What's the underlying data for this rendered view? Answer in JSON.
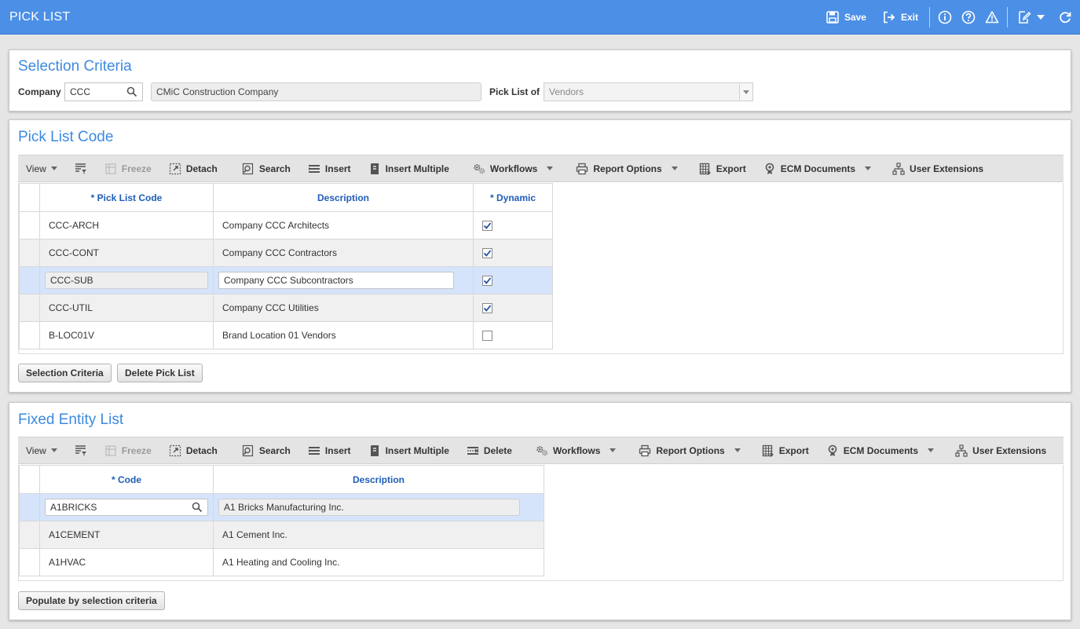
{
  "header": {
    "title": "PICK LIST",
    "save_label": "Save",
    "exit_label": "Exit"
  },
  "selection_criteria": {
    "title": "Selection Criteria",
    "company_label": "Company",
    "company_value": "CCC",
    "company_name": "CMiC Construction Company",
    "pick_list_of_label": "Pick List of",
    "pick_list_of_value": "Vendors"
  },
  "toolbar_labels": {
    "view": "View",
    "freeze": "Freeze",
    "detach": "Detach",
    "search": "Search",
    "insert": "Insert",
    "insert_multiple": "Insert Multiple",
    "delete": "Delete",
    "workflows": "Workflows",
    "report_options": "Report Options",
    "export": "Export",
    "ecm_documents": "ECM Documents",
    "user_extensions": "User Extensions"
  },
  "pick_list_code": {
    "title": "Pick List Code",
    "columns": [
      "* Pick List Code",
      "Description",
      "* Dynamic"
    ],
    "rows": [
      {
        "code": "CCC-ARCH",
        "description": "Company CCC Architects",
        "dynamic": true
      },
      {
        "code": "CCC-CONT",
        "description": "Company CCC Contractors",
        "dynamic": true
      },
      {
        "code": "CCC-SUB",
        "description": "Company CCC Subcontractors",
        "dynamic": true
      },
      {
        "code": "CCC-UTIL",
        "description": "Company CCC Utilities",
        "dynamic": true
      },
      {
        "code": "B-LOC01V",
        "description": "Brand Location 01 Vendors",
        "dynamic": false
      }
    ],
    "selection_criteria_button": "Selection Criteria",
    "delete_button": "Delete Pick List"
  },
  "fixed_entity_list": {
    "title": "Fixed Entity List",
    "columns": [
      "* Code",
      "Description"
    ],
    "rows": [
      {
        "code": "A1BRICKS",
        "description": "A1 Bricks Manufacturing Inc."
      },
      {
        "code": "A1CEMENT",
        "description": "A1 Cement Inc."
      },
      {
        "code": "A1HVAC",
        "description": "A1 Heating and Cooling Inc."
      }
    ],
    "populate_button": "Populate by selection criteria"
  }
}
